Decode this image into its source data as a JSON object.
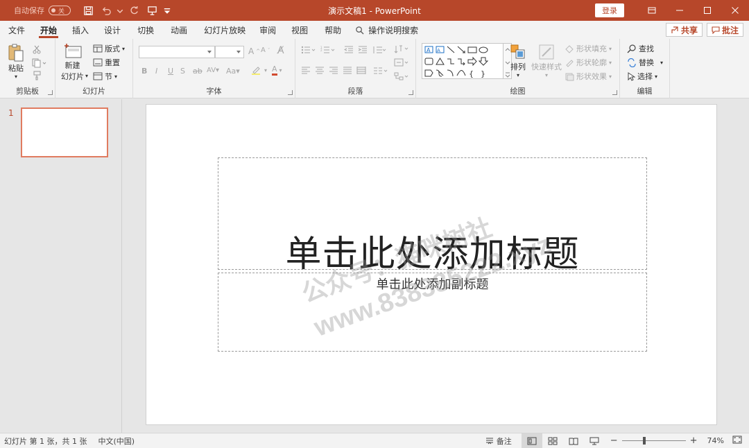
{
  "titlebar": {
    "autosave_label": "自动保存",
    "autosave_state": "关",
    "doc_title": "演示文稿1  -  PowerPoint",
    "login_label": "登录"
  },
  "tabs": {
    "items": [
      "文件",
      "开始",
      "插入",
      "设计",
      "切换",
      "动画",
      "幻灯片放映",
      "审阅",
      "视图",
      "帮助"
    ],
    "active": "开始",
    "tell_me": "操作说明搜索",
    "share_label": "共享",
    "comment_label": "批注"
  },
  "ribbon": {
    "clipboard": {
      "label": "剪贴板",
      "paste": "粘贴"
    },
    "slides": {
      "label": "幻灯片",
      "new_slide_1": "新建",
      "new_slide_2": "幻灯片",
      "layout": "版式",
      "reset": "重置",
      "section": "节"
    },
    "font": {
      "label": "字体"
    },
    "paragraph": {
      "label": "段落"
    },
    "drawing": {
      "label": "绘图",
      "arrange": "排列",
      "quick_styles": "快速样式",
      "shape_fill": "形状填充",
      "shape_outline": "形状轮廓",
      "shape_effects": "形状效果"
    },
    "editing": {
      "label": "编辑",
      "find": "查找",
      "replace": "替换",
      "select": "选择"
    }
  },
  "thumbs": {
    "slide_number": "1"
  },
  "slide": {
    "title_placeholder": "单击此处添加标题",
    "subtitle_placeholder": "单击此处添加副标题",
    "watermark_line1": "公众号：猫咪树社",
    "watermark_line2": "www.838385222.xyz"
  },
  "statusbar": {
    "slide_info": "幻灯片 第 1 张，共 1 张",
    "language": "中文(中国)",
    "notes_label": "备注",
    "zoom_level": "74%",
    "zoom_fraction": 0.74
  },
  "colors": {
    "accent": "#b7472a",
    "thumb_border": "#e07b5f"
  }
}
